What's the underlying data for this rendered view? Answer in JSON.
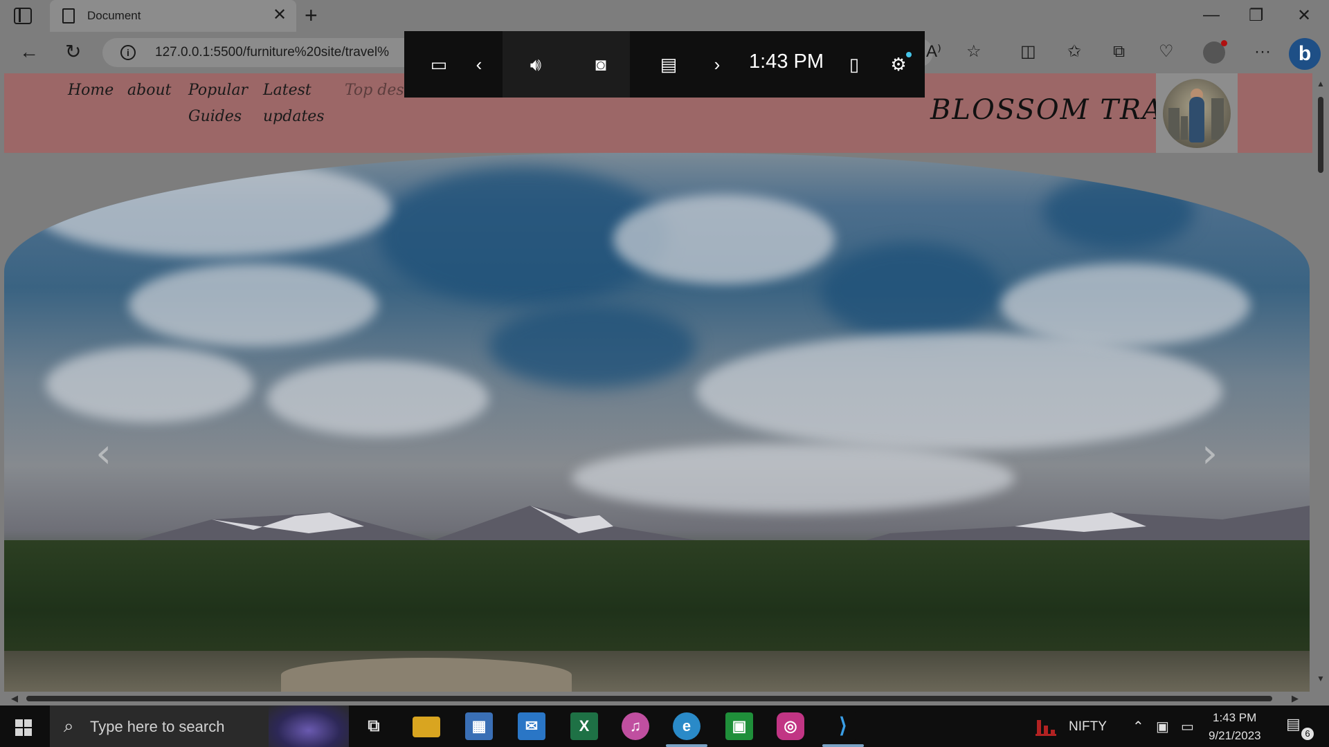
{
  "browser": {
    "tab_title": "Document",
    "tab_close": "✕",
    "new_tab": "+",
    "url": "127.0.0.1:5500/furniture%20site/travel%",
    "controls": {
      "minimize": "—",
      "restore": "❐",
      "close": "✕"
    },
    "icons": [
      "sidebar-toggle-icon",
      "document-icon",
      "back-icon",
      "refresh-icon",
      "info-icon",
      "read-aloud-icon",
      "favorite-star-icon",
      "split-screen-icon",
      "favorites-icon",
      "collections-icon",
      "browser-essentials-icon",
      "profile-icon",
      "more-icon",
      "bing-copilot-icon"
    ]
  },
  "site": {
    "menu": [
      {
        "label_line1": "Home",
        "label_line2": ""
      },
      {
        "label_line1": "about",
        "label_line2": ""
      },
      {
        "label_line1": "Popular",
        "label_line2": "Guides"
      },
      {
        "label_line1": "Latest",
        "label_line2": "updates"
      },
      {
        "label_line1": "Top destinations",
        "label_line2": ""
      }
    ],
    "brand": "BLOSSOM TRAVEL",
    "carousel": {
      "prev": "‹",
      "next": "›"
    }
  },
  "gamebar": {
    "time": "1:43 PM",
    "icons": [
      "widget-menu-icon",
      "previous-icon",
      "audio-icon",
      "capture-icon",
      "performance-icon",
      "next-icon",
      "mouse-icon",
      "settings-icon"
    ]
  },
  "taskbar": {
    "search_placeholder": "Type here to search",
    "apps": [
      "task-view",
      "file-explorer",
      "microsoft-store",
      "mail",
      "excel",
      "itunes",
      "edge",
      "google-classroom",
      "instagram",
      "vscode"
    ],
    "nifty_label": "NIFTY",
    "time": "1:43 PM",
    "date": "9/21/2023",
    "notification_count": "6"
  },
  "colors": {
    "header_bg": "#9c6767",
    "gamebar_bg": "#0f0f0f",
    "taskbar_bg": "#0e0e0e"
  }
}
